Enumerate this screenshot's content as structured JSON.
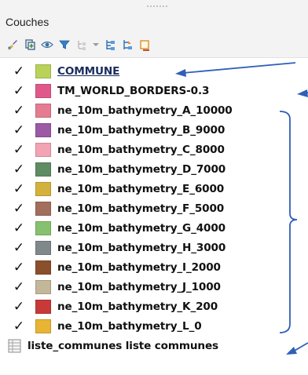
{
  "panel": {
    "title": "Couches"
  },
  "toolbar": {
    "icons": [
      "style-brush-icon",
      "add-group-icon",
      "eye-icon",
      "filter-icon",
      "filter-legend-icon",
      "expand-all-icon",
      "collapse-all-icon",
      "remove-layer-icon"
    ]
  },
  "layers": [
    {
      "name": "COMMUNE",
      "checked": "✓",
      "color": "#b9d35a",
      "selected": true
    },
    {
      "name": "TM_WORLD_BORDERS-0.3",
      "checked": "✓",
      "color": "#e0588a"
    },
    {
      "name": "ne_10m_bathymetry_A_10000",
      "checked": "✓",
      "color": "#e57c92"
    },
    {
      "name": "ne_10m_bathymetry_B_9000",
      "checked": "✓",
      "color": "#9b59a6"
    },
    {
      "name": "ne_10m_bathymetry_C_8000",
      "checked": "✓",
      "color": "#f2a3b4"
    },
    {
      "name": "ne_10m_bathymetry_D_7000",
      "checked": "✓",
      "color": "#5e8c63"
    },
    {
      "name": "ne_10m_bathymetry_E_6000",
      "checked": "✓",
      "color": "#d4b13e"
    },
    {
      "name": "ne_10m_bathymetry_F_5000",
      "checked": "✓",
      "color": "#a16f5c"
    },
    {
      "name": "ne_10m_bathymetry_G_4000",
      "checked": "✓",
      "color": "#87c06f"
    },
    {
      "name": "ne_10m_bathymetry_H_3000",
      "checked": "✓",
      "color": "#7f888b"
    },
    {
      "name": "ne_10m_bathymetry_I_2000",
      "checked": "✓",
      "color": "#8a4f2c"
    },
    {
      "name": "ne_10m_bathymetry_J_1000",
      "checked": "✓",
      "color": "#c3b79a"
    },
    {
      "name": "ne_10m_bathymetry_K_200",
      "checked": "✓",
      "color": "#c73a37"
    },
    {
      "name": "ne_10m_bathymetry_L_0",
      "checked": "✓",
      "color": "#e7b533"
    }
  ],
  "table_layer": {
    "name": "liste_communes liste communes",
    "icon": "table-icon"
  },
  "annotations": {
    "color": "#2f5fb8"
  }
}
